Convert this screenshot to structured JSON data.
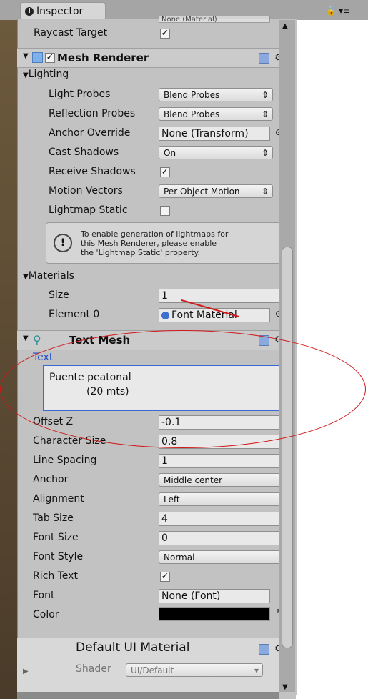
{
  "window": {
    "tab_title": "Inspector",
    "raycast_target_label": "Raycast Target",
    "material_field_partial": "None (Material)"
  },
  "mesh_renderer": {
    "title": "Mesh Renderer",
    "lighting_label": "Lighting",
    "light_probes": {
      "label": "Light Probes",
      "value": "Blend Probes"
    },
    "reflection_probes": {
      "label": "Reflection Probes",
      "value": "Blend Probes"
    },
    "anchor_override": {
      "label": "Anchor Override",
      "value": "None (Transform)"
    },
    "cast_shadows": {
      "label": "Cast Shadows",
      "value": "On"
    },
    "receive_shadows": {
      "label": "Receive Shadows",
      "checked": true
    },
    "motion_vectors": {
      "label": "Motion Vectors",
      "value": "Per Object Motion"
    },
    "lightmap_static": {
      "label": "Lightmap Static",
      "checked": false
    },
    "help_line1": "To enable generation of lightmaps for",
    "help_line2": "this Mesh Renderer, please enable",
    "help_line3": "the 'Lightmap Static' property.",
    "materials_label": "Materials",
    "size": {
      "label": "Size",
      "value": "1"
    },
    "element0": {
      "label": "Element 0",
      "value": "Font Material"
    }
  },
  "text_mesh": {
    "title": "Text Mesh",
    "text_label": "Text",
    "text_line1": "Puente peatonal",
    "text_line2": "(20 mts)",
    "offset_z": {
      "label": "Offset Z",
      "value": "-0.1"
    },
    "character_size": {
      "label": "Character Size",
      "value": "0.8"
    },
    "line_spacing": {
      "label": "Line Spacing",
      "value": "1"
    },
    "anchor": {
      "label": "Anchor",
      "value": "Middle center"
    },
    "alignment": {
      "label": "Alignment",
      "value": "Left"
    },
    "tab_size": {
      "label": "Tab Size",
      "value": "4"
    },
    "font_size": {
      "label": "Font Size",
      "value": "0"
    },
    "font_style": {
      "label": "Font Style",
      "value": "Normal"
    },
    "rich_text": {
      "label": "Rich Text",
      "checked": true
    },
    "font": {
      "label": "Font",
      "value": "None (Font)"
    },
    "color": {
      "label": "Color",
      "value": "#000000"
    }
  },
  "default_material": {
    "title": "Default UI Material",
    "shader_label": "Shader",
    "shader_value": "UI/Default"
  }
}
